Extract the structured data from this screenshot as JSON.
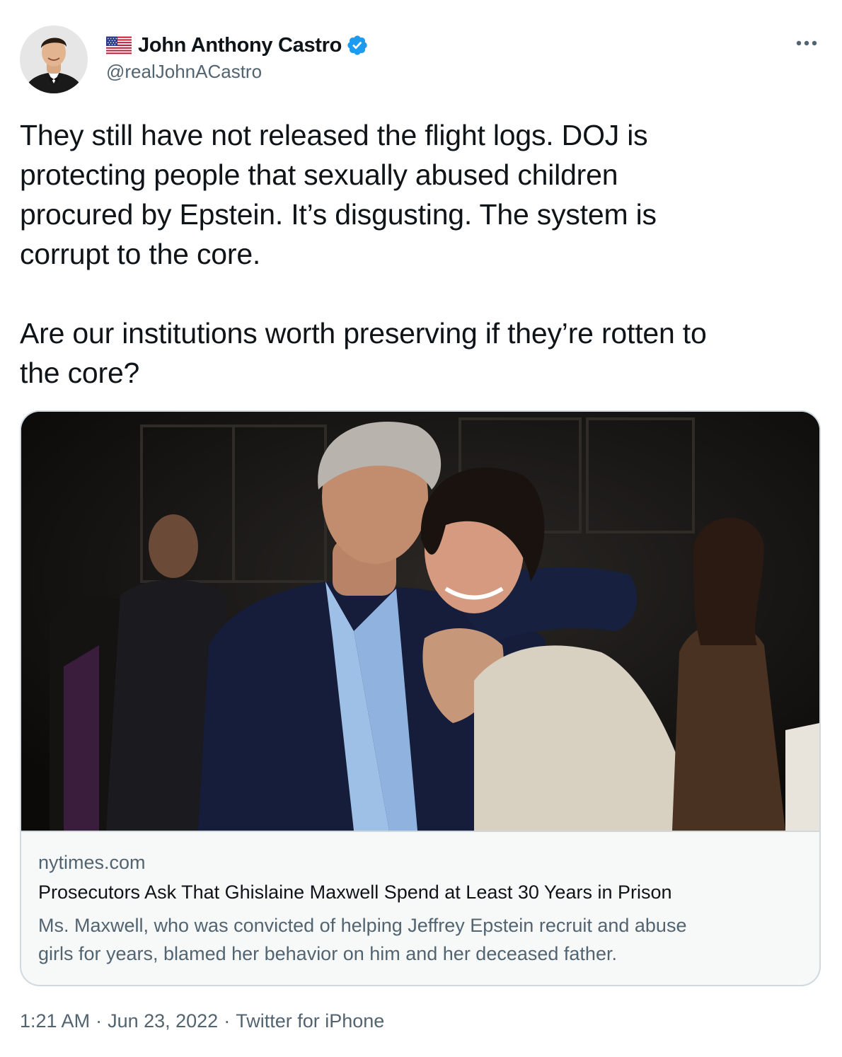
{
  "author": {
    "display_name": "John Anthony Castro",
    "handle": "@realJohnACastro",
    "flag_icon": "us-flag-icon",
    "verified_icon": "verified-badge-icon",
    "verified_color": "#1d9bf0"
  },
  "menu": {
    "more_icon": "more-horizontal-icon"
  },
  "tweet": {
    "text": "They still have not released the flight logs. DOJ is\nprotecting people that sexually abused children\nprocured by Epstein. It’s disgusting. The system is\ncorrupt to the core.\n\nAre our institutions worth preserving if they’re rotten to\nthe core?"
  },
  "link_card": {
    "domain": "nytimes.com",
    "title": "Prosecutors Ask That Ghislaine Maxwell Spend at Least 30 Years in Prison",
    "description_line1": "Ms. Maxwell, who was convicted of helping Jeffrey Epstein recruit and abuse",
    "description_line2": "girls for years, blamed her behavior on him and her deceased father."
  },
  "meta": {
    "time": "1:21 AM",
    "separator1": "·",
    "date": "Jun 23, 2022",
    "separator2": "·",
    "source": "Twitter for iPhone"
  },
  "colors": {
    "text": "#0f1419",
    "secondary": "#536471",
    "border": "#cfd9de",
    "accent": "#1d9bf0"
  }
}
